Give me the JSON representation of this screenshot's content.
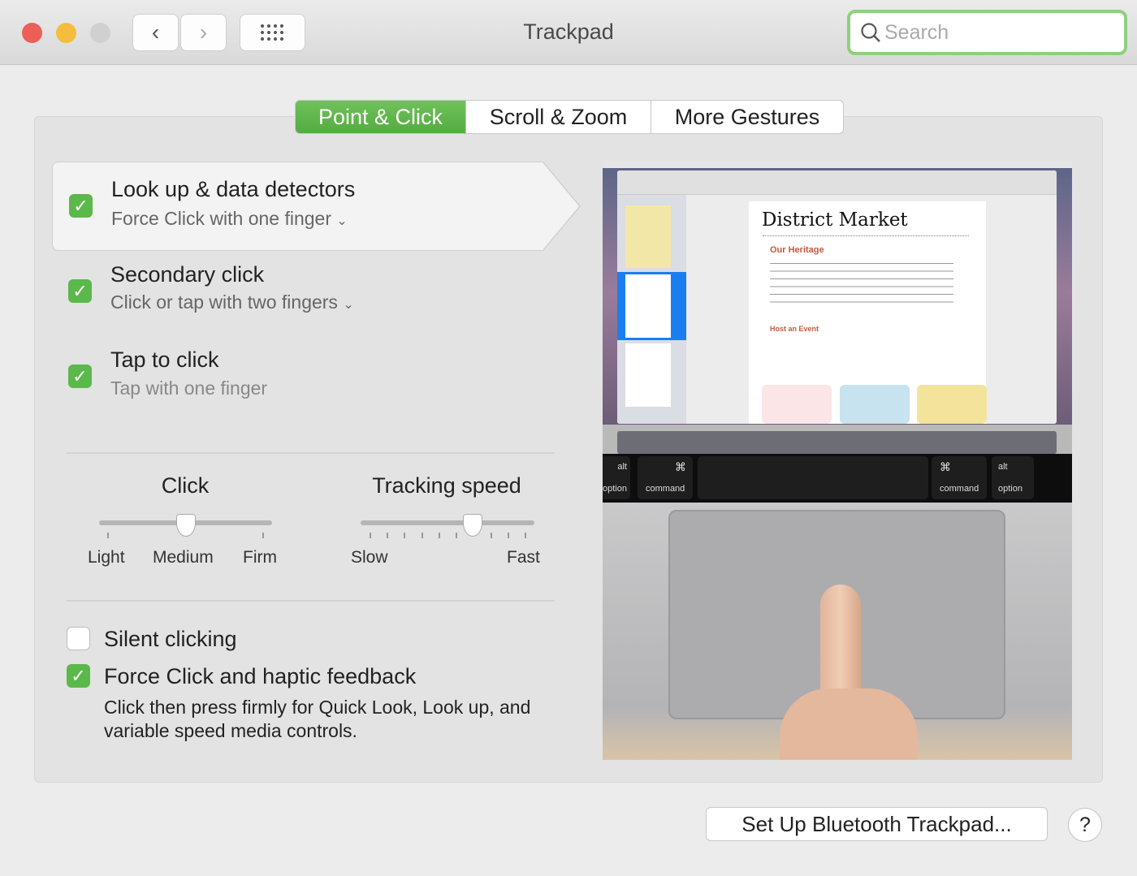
{
  "window": {
    "title": "Trackpad",
    "search_placeholder": "Search",
    "traffic_lights": {
      "close": "#ec5f57",
      "minimize": "#f5bd3c",
      "zoom": "#cfcfcf"
    },
    "nav": {
      "back_icon": "chevron-left-icon",
      "forward_icon": "chevron-right-icon",
      "grid_icon": "grid-icon"
    }
  },
  "tabs": [
    {
      "label": "Point & Click",
      "active": true
    },
    {
      "label": "Scroll & Zoom",
      "active": false
    },
    {
      "label": "More Gestures",
      "active": false
    }
  ],
  "accent": "#5bb84a",
  "options": [
    {
      "title": "Look up & data detectors",
      "subtitle": "Force Click with one finger",
      "checked": true,
      "has_menu": true,
      "selected": true
    },
    {
      "title": "Secondary click",
      "subtitle": "Click or tap with two fingers",
      "checked": true,
      "has_menu": true
    },
    {
      "title": "Tap to click",
      "subtitle": "Tap with one finger",
      "checked": true,
      "has_menu": false
    }
  ],
  "click": {
    "label": "Click",
    "ticks": [
      "Light",
      "Medium",
      "Firm"
    ],
    "value": "Medium"
  },
  "tracking": {
    "label": "Tracking speed",
    "min_label": "Slow",
    "max_label": "Fast",
    "tick_count": 10,
    "value": 7
  },
  "silent_clicking": {
    "label": "Silent clicking",
    "checked": false
  },
  "force_click": {
    "label": "Force Click and haptic feedback",
    "checked": true,
    "description": "Click then press firmly for Quick Look, Look up, and variable speed media controls."
  },
  "preview": {
    "doc_title": "District Market",
    "heading1": "Our Heritage",
    "heading2": "Host an Event",
    "keys": {
      "alt": "alt",
      "option": "option",
      "command": "command",
      "cmd_symbol": "⌘"
    }
  },
  "footer": {
    "bluetooth_button": "Set Up Bluetooth Trackpad...",
    "help": "?"
  }
}
